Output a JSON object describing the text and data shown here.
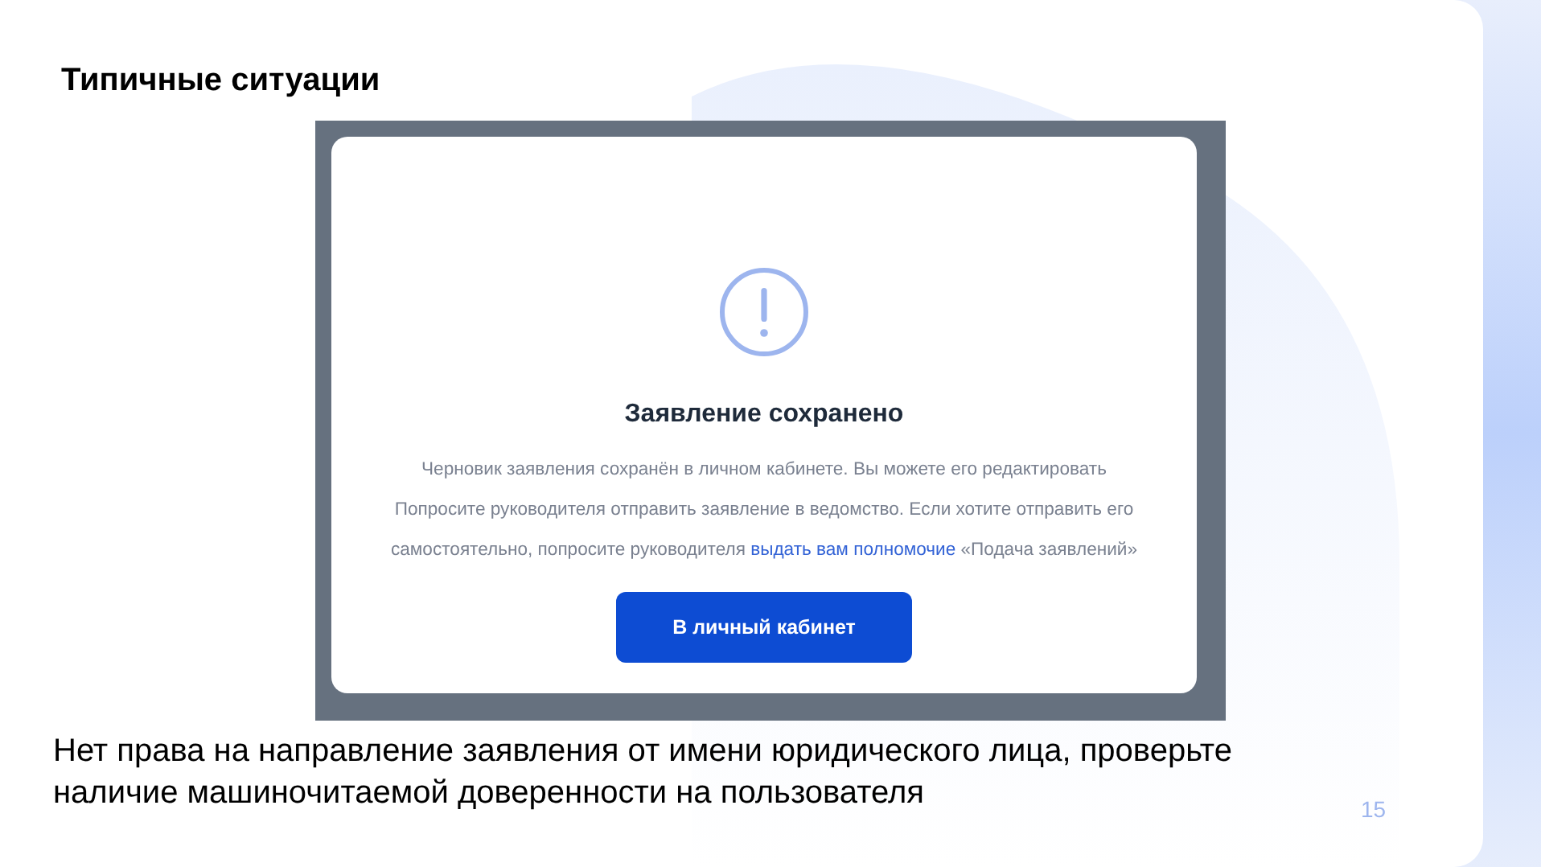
{
  "slide_title": "Типичные ситуации",
  "dialog": {
    "title": "Заявление сохранено",
    "message": {
      "text": "Черновик заявления сохранён в личном кабинете. Вы можете его редактировать\nПопросите руководителя отправить заявление в ведомство. Если хотите отправить его самостоятельно, попросите руководителя ",
      "link": "выдать вам полномочие",
      "text_after": " «Подача заявлений»"
    },
    "button": "В личный кабинет"
  },
  "caption": "Нет права на направление заявления от имени юридического лица, проверьте наличие машиночитаемой доверенности на пользователя",
  "page_number": "15"
}
